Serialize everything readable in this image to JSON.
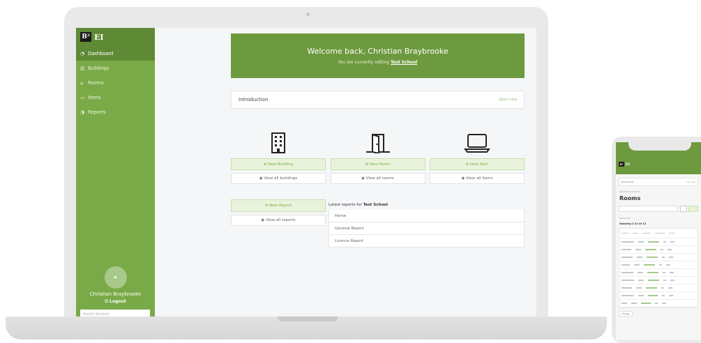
{
  "app": {
    "logo_mark": "B²",
    "logo_text": "EI"
  },
  "sidebar": {
    "items": [
      {
        "label": "Dashboard",
        "icon": "dashboard-icon",
        "active": true
      },
      {
        "label": "Buildings",
        "icon": "building-icon",
        "active": false
      },
      {
        "label": "Rooms",
        "icon": "door-icon",
        "active": false
      },
      {
        "label": "Items",
        "icon": "laptop-icon",
        "active": false
      },
      {
        "label": "Reports",
        "icon": "pie-chart-icon",
        "active": false
      }
    ],
    "user_name": "Christian Braybrooke",
    "logout_label": "Logout",
    "switch_placeholder": "Switch Schools"
  },
  "welcome": {
    "title": "Welcome back, Christian Braybrooke",
    "subtitle_prefix": "You are currently editing",
    "school": "Test School"
  },
  "intro": {
    "label": "Introduction",
    "link": "Open help"
  },
  "cards": [
    {
      "icon": "building-icon",
      "new_label": "New Building",
      "view_label": "View all buildings"
    },
    {
      "icon": "door-icon",
      "new_label": "New Room",
      "view_label": "View all rooms"
    },
    {
      "icon": "laptop-icon",
      "new_label": "New Item",
      "view_label": "View all items"
    }
  ],
  "reports": {
    "new_label": "New Report",
    "view_label": "View all reports",
    "heading_prefix": "Latest reports for",
    "school": "Test School",
    "items": [
      "Home",
      "General Report",
      "Licence Report"
    ]
  },
  "mobile": {
    "help_label": "Rooms Help",
    "help_link": "Get help",
    "crumb": "Test School / Rooms",
    "title": "Rooms",
    "new_link": "New Room",
    "subtitle": "Showing 1-12 of 12",
    "footer_label": "Change"
  },
  "colors": {
    "brand_green": "#7aaa47",
    "brand_green_dark": "#5e8a35",
    "banner_green": "#6e9a3f"
  }
}
